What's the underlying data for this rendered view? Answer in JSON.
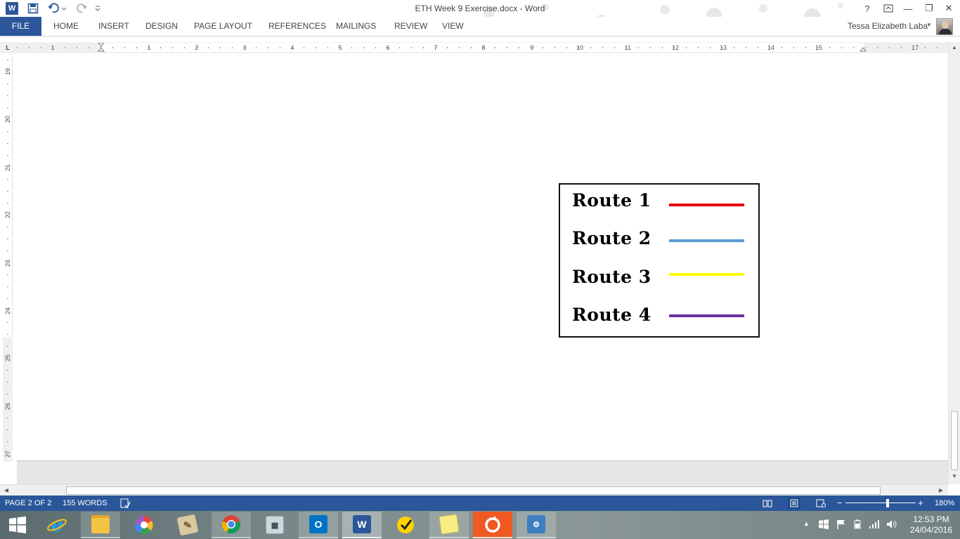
{
  "window": {
    "title": "ETH Week 9 Exercise.docx - Word",
    "help": "?",
    "controls": [
      "—",
      "❐",
      "✕"
    ]
  },
  "quick_access": {
    "app_icon": "W",
    "icons": [
      "save-icon",
      "undo-icon",
      "redo-icon",
      "customize-icon"
    ]
  },
  "ribbon": {
    "tabs": [
      "FILE",
      "HOME",
      "INSERT",
      "DESIGN",
      "PAGE LAYOUT",
      "REFERENCES",
      "MAILINGS",
      "REVIEW",
      "VIEW"
    ],
    "user_name": "Tessa Elizabeth Laba"
  },
  "ruler": {
    "tab_selector": "L",
    "h_labels": [
      "1",
      "1",
      "2",
      "3",
      "4",
      "5",
      "6",
      "7",
      "8",
      "9",
      "10",
      "11",
      "12",
      "13",
      "14",
      "15",
      "17"
    ],
    "v_labels": [
      "19",
      "20",
      "21",
      "22",
      "23",
      "24",
      "25",
      "26",
      "27"
    ]
  },
  "legend": {
    "routes": [
      {
        "label": "Route 1",
        "color": "#e3000f"
      },
      {
        "label": "Route 2",
        "color": "#5b9bd5"
      },
      {
        "label": "Route 3",
        "color": "#ffff00"
      },
      {
        "label": "Route 4",
        "color": "#7030a0"
      }
    ]
  },
  "status": {
    "page": "PAGE 2 OF 2",
    "words": "155 WORDS",
    "zoom": "180%",
    "zoom_minus": "−",
    "zoom_plus": "+"
  },
  "taskbar": {
    "apps": [
      "start",
      "internet-explorer",
      "file-explorer",
      "picasa",
      "scratch",
      "chrome",
      "calculator",
      "outlook",
      "word",
      "norton",
      "sticky-notes",
      "origin",
      "control-panel"
    ],
    "time": "12:53 PM",
    "date": "24/04/2016"
  },
  "colors": {
    "accent": "#2b579a"
  }
}
